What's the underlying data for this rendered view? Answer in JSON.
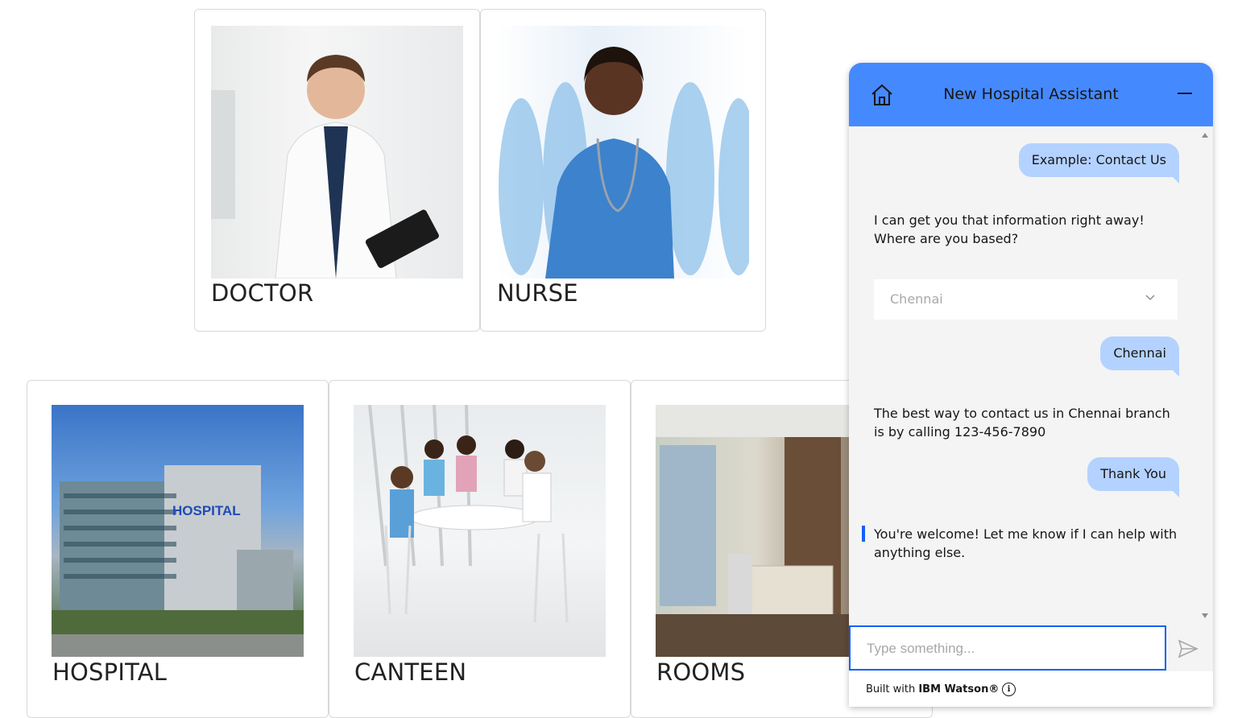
{
  "cards": {
    "doctor": {
      "label": "DOCTOR"
    },
    "nurse": {
      "label": "NURSE"
    },
    "hospital": {
      "label": "HOSPITAL",
      "sign": "HOSPITAL"
    },
    "canteen": {
      "label": "CANTEEN"
    },
    "rooms": {
      "label": "ROOMS"
    }
  },
  "chat": {
    "title": "New Hospital Assistant",
    "messages": [
      {
        "from": "user",
        "text": "Example: Contact Us"
      },
      {
        "from": "bot",
        "text": "I can get you that information right away! Where are you based?"
      },
      {
        "from": "user",
        "text": "Chennai"
      },
      {
        "from": "bot",
        "text": "The best way to contact us in Chennai branch is by calling 123-456-7890"
      },
      {
        "from": "user",
        "text": "Thank You"
      },
      {
        "from": "bot",
        "text": "You're welcome! Let me know if I can help with anything else."
      }
    ],
    "dropdown": {
      "selected": "Chennai"
    },
    "input_placeholder": "Type something...",
    "footer_prefix": "Built with ",
    "footer_brand": "IBM Watson®",
    "icons": [
      "home-icon",
      "minimize-icon",
      "chevron-down-icon",
      "send-icon",
      "info-icon"
    ]
  },
  "colors": {
    "header": "#4589ff",
    "user_bubble": "#b4d2ff",
    "focus": "#0f62fe",
    "chat_bg": "#f4f4f4"
  }
}
